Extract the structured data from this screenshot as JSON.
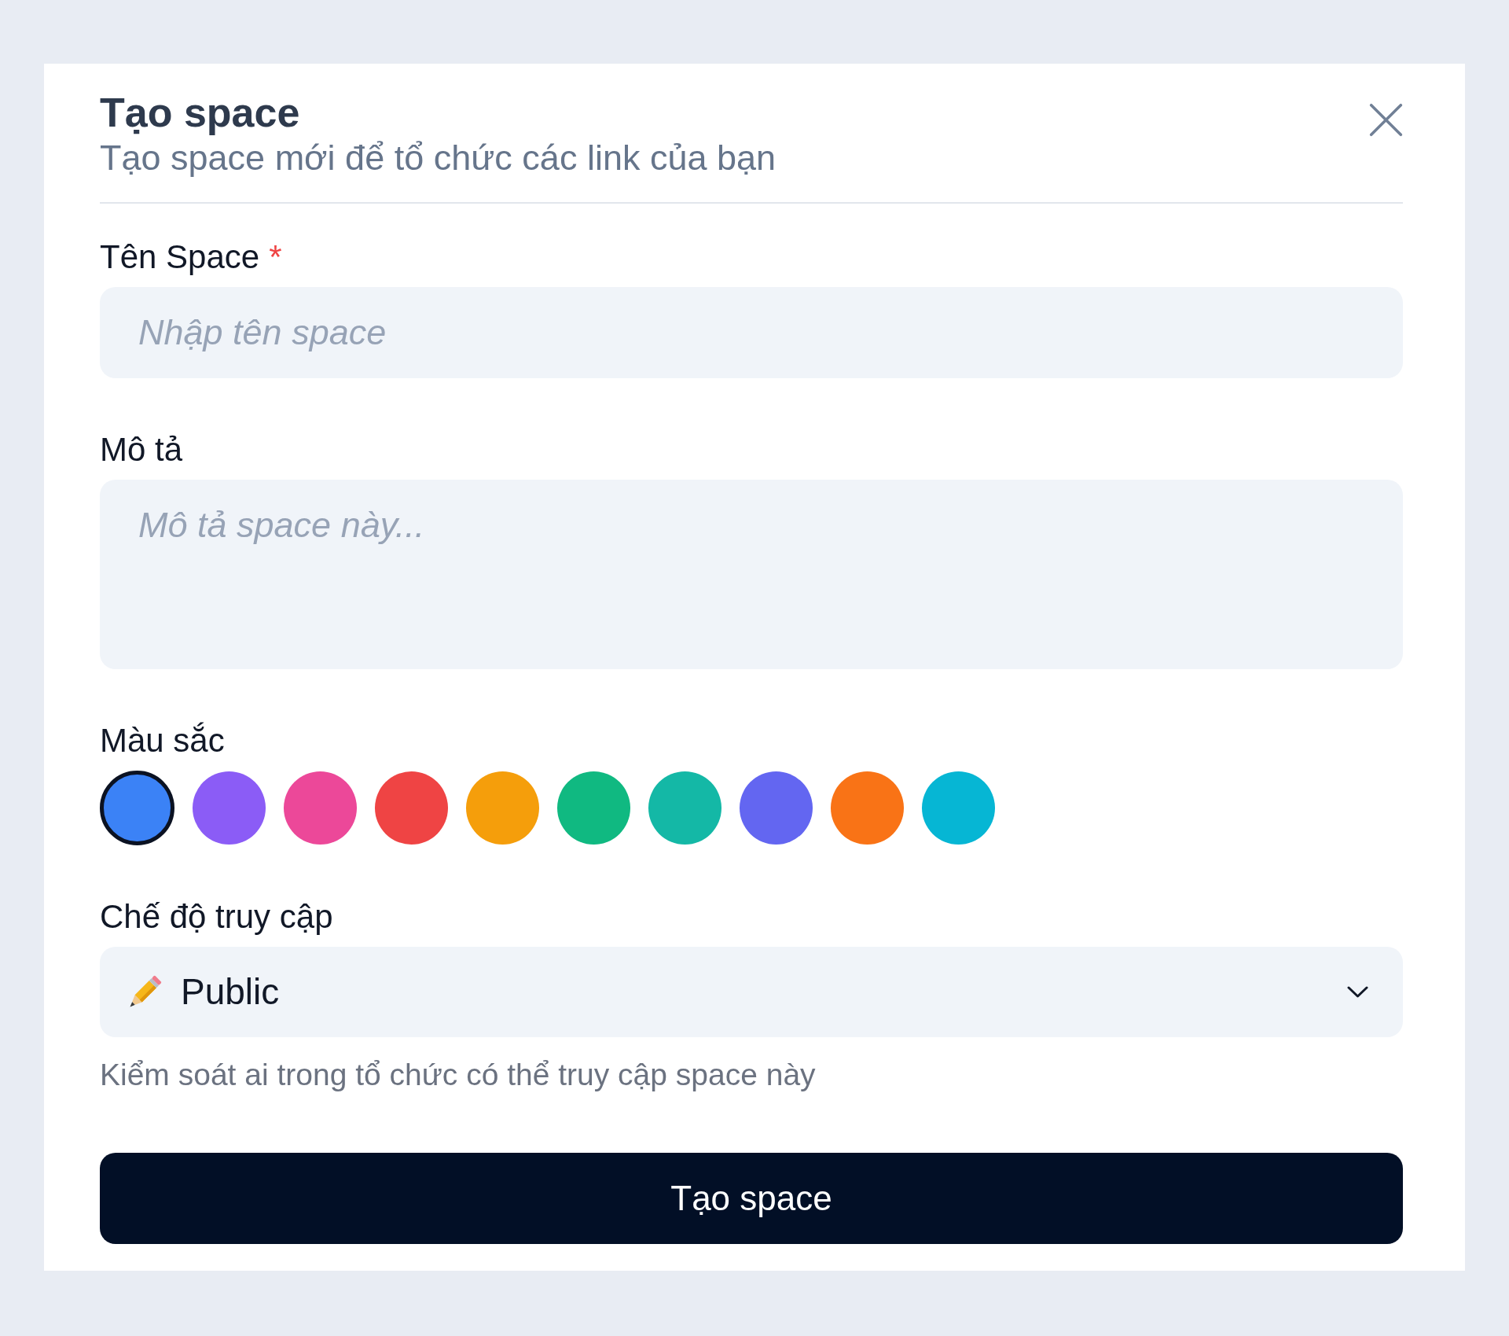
{
  "dialog": {
    "title": "Tạo space",
    "subtitle": "Tạo space mới để tổ chức các link của bạn"
  },
  "fields": [
    {
      "kind": "input",
      "label": "Tên Space",
      "required_mark": "*",
      "placeholder": "Nhập tên space"
    },
    {
      "kind": "textarea",
      "label": "Mô tả",
      "placeholder": "Mô tả space này..."
    },
    {
      "kind": "colors",
      "label": "Màu sắc",
      "options": [
        {
          "color": "#3b82f6",
          "selected": true
        },
        {
          "color": "#8b5cf6",
          "selected": false
        },
        {
          "color": "#ec4899",
          "selected": false
        },
        {
          "color": "#ef4444",
          "selected": false
        },
        {
          "color": "#f59e0b",
          "selected": false
        },
        {
          "color": "#10b981",
          "selected": false
        },
        {
          "color": "#14b8a6",
          "selected": false
        },
        {
          "color": "#6366f1",
          "selected": false
        },
        {
          "color": "#f97316",
          "selected": false
        },
        {
          "color": "#06b6d4",
          "selected": false
        }
      ]
    },
    {
      "kind": "select",
      "label": "Chế độ truy cập",
      "value": "Public",
      "help": "Kiểm soát ai trong tổ chức có thể truy cập space này"
    }
  ],
  "submit_button": "Tạo space"
}
